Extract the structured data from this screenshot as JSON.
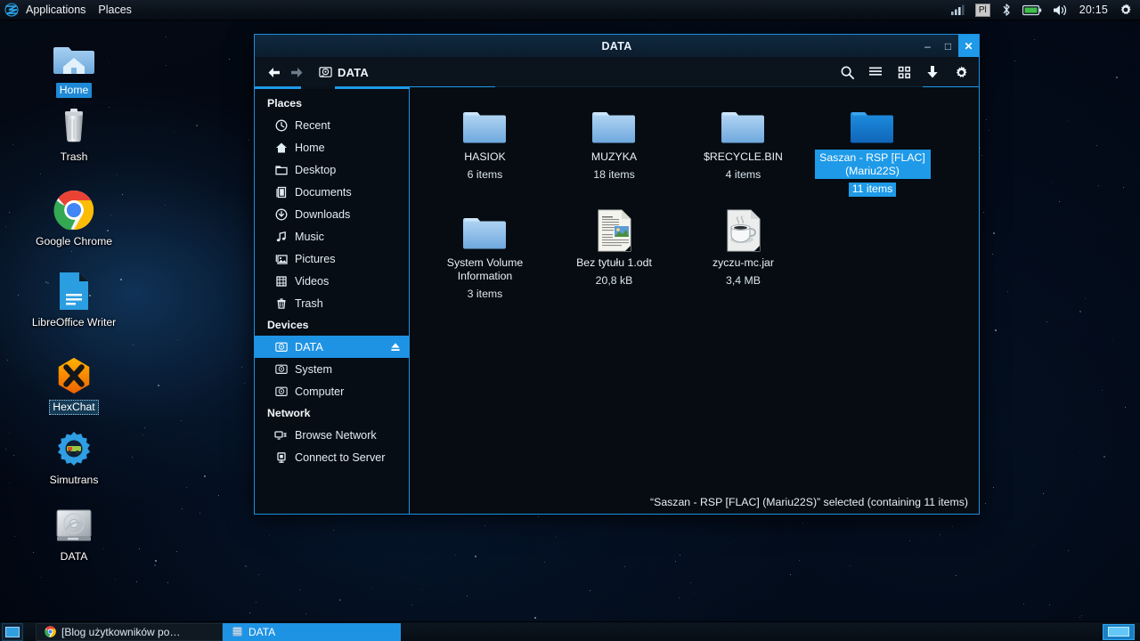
{
  "top_panel": {
    "logo_icon": "zorin-logo-icon",
    "menus": [
      {
        "label": "Applications",
        "name": "applications-menu"
      },
      {
        "label": "Places",
        "name": "places-menu"
      }
    ],
    "tray": {
      "signal_icon": "signal-strength-icon",
      "keyboard_layout": "Pl",
      "bluetooth_icon": "bluetooth-icon",
      "battery_icon": "battery-icon",
      "volume_icon": "volume-icon",
      "clock": "20:15",
      "settings_icon": "gear-icon"
    }
  },
  "desktop": {
    "icons": [
      {
        "label": "Home",
        "icon": "home-folder-icon",
        "state": "selected"
      },
      {
        "label": "Trash",
        "icon": "trash-icon",
        "state": "normal"
      },
      {
        "label": "Google Chrome",
        "icon": "google-chrome-icon",
        "state": "normal"
      },
      {
        "label": "LibreOffice Writer",
        "icon": "libreoffice-writer-icon",
        "state": "normal"
      },
      {
        "label": "HexChat",
        "icon": "hexchat-icon",
        "state": "focused"
      },
      {
        "label": "Simutrans",
        "icon": "simutrans-icon",
        "state": "normal"
      },
      {
        "label": "DATA",
        "icon": "hard-disk-icon",
        "state": "normal"
      }
    ]
  },
  "file_manager": {
    "title": "DATA",
    "window_controls": {
      "minimize": "–",
      "maximize": "□",
      "close": "✕"
    },
    "toolbar": {
      "back_icon": "arrow-left-icon",
      "forward_icon": "arrow-right-icon",
      "path_icon": "drive-icon",
      "path_label": "DATA",
      "search_icon": "search-icon",
      "list_view_icon": "list-view-icon",
      "grid_view_icon": "grid-view-icon",
      "download_icon": "download-arrow-icon",
      "settings_icon": "gear-icon"
    },
    "sidebar": {
      "sections": [
        {
          "title": "Places",
          "items": [
            {
              "label": "Recent",
              "icon": "clock-icon"
            },
            {
              "label": "Home",
              "icon": "home-icon"
            },
            {
              "label": "Desktop",
              "icon": "desktop-folder-icon"
            },
            {
              "label": "Documents",
              "icon": "documents-icon"
            },
            {
              "label": "Downloads",
              "icon": "downloads-icon"
            },
            {
              "label": "Music",
              "icon": "music-note-icon"
            },
            {
              "label": "Pictures",
              "icon": "pictures-icon"
            },
            {
              "label": "Videos",
              "icon": "videos-icon"
            },
            {
              "label": "Trash",
              "icon": "trash-icon"
            }
          ]
        },
        {
          "title": "Devices",
          "items": [
            {
              "label": "DATA",
              "icon": "drive-icon",
              "active": true,
              "eject": true
            },
            {
              "label": "System",
              "icon": "drive-icon"
            },
            {
              "label": "Computer",
              "icon": "drive-icon"
            }
          ]
        },
        {
          "title": "Network",
          "items": [
            {
              "label": "Browse Network",
              "icon": "network-browse-icon"
            },
            {
              "label": "Connect to Server",
              "icon": "server-connect-icon"
            }
          ]
        }
      ]
    },
    "files": [
      {
        "name": "HASIOK",
        "meta": "6 items",
        "icon": "folder-icon",
        "selected": false
      },
      {
        "name": "MUZYKA",
        "meta": "18 items",
        "icon": "folder-icon",
        "selected": false
      },
      {
        "name": "$RECYCLE.BIN",
        "meta": "4 items",
        "icon": "folder-icon",
        "selected": false
      },
      {
        "name": "Saszan - RSP [FLAC] (Mariu22S)",
        "meta": "11 items",
        "icon": "folder-icon",
        "selected": true
      },
      {
        "name": "System Volume Information",
        "meta": "3 items",
        "icon": "folder-icon",
        "selected": false
      },
      {
        "name": "Bez tytułu 1.odt",
        "meta": "20,8 kB",
        "icon": "odt-document-icon",
        "selected": false
      },
      {
        "name": "zyczu-mc.jar",
        "meta": "3,4 MB",
        "icon": "java-jar-icon",
        "selected": false
      }
    ],
    "status_text": "“Saszan - RSP [FLAC] (Mariu22S)” selected  (containing 11 items)"
  },
  "taskbar": {
    "show_desktop_icon": "show-desktop-icon",
    "tasks": [
      {
        "label": "[Blog użytkowników po…",
        "icon": "google-chrome-icon",
        "active": false
      },
      {
        "label": "DATA",
        "icon": "file-manager-icon",
        "active": true
      }
    ],
    "workspaces": [
      {
        "active": true
      }
    ]
  },
  "colors": {
    "accent": "#1e9ae8",
    "window_border": "#1d8fe0",
    "panel_bg": "#0b121b",
    "folder_blue": "#8fc3ee",
    "folder_selected": "#1279d4"
  }
}
